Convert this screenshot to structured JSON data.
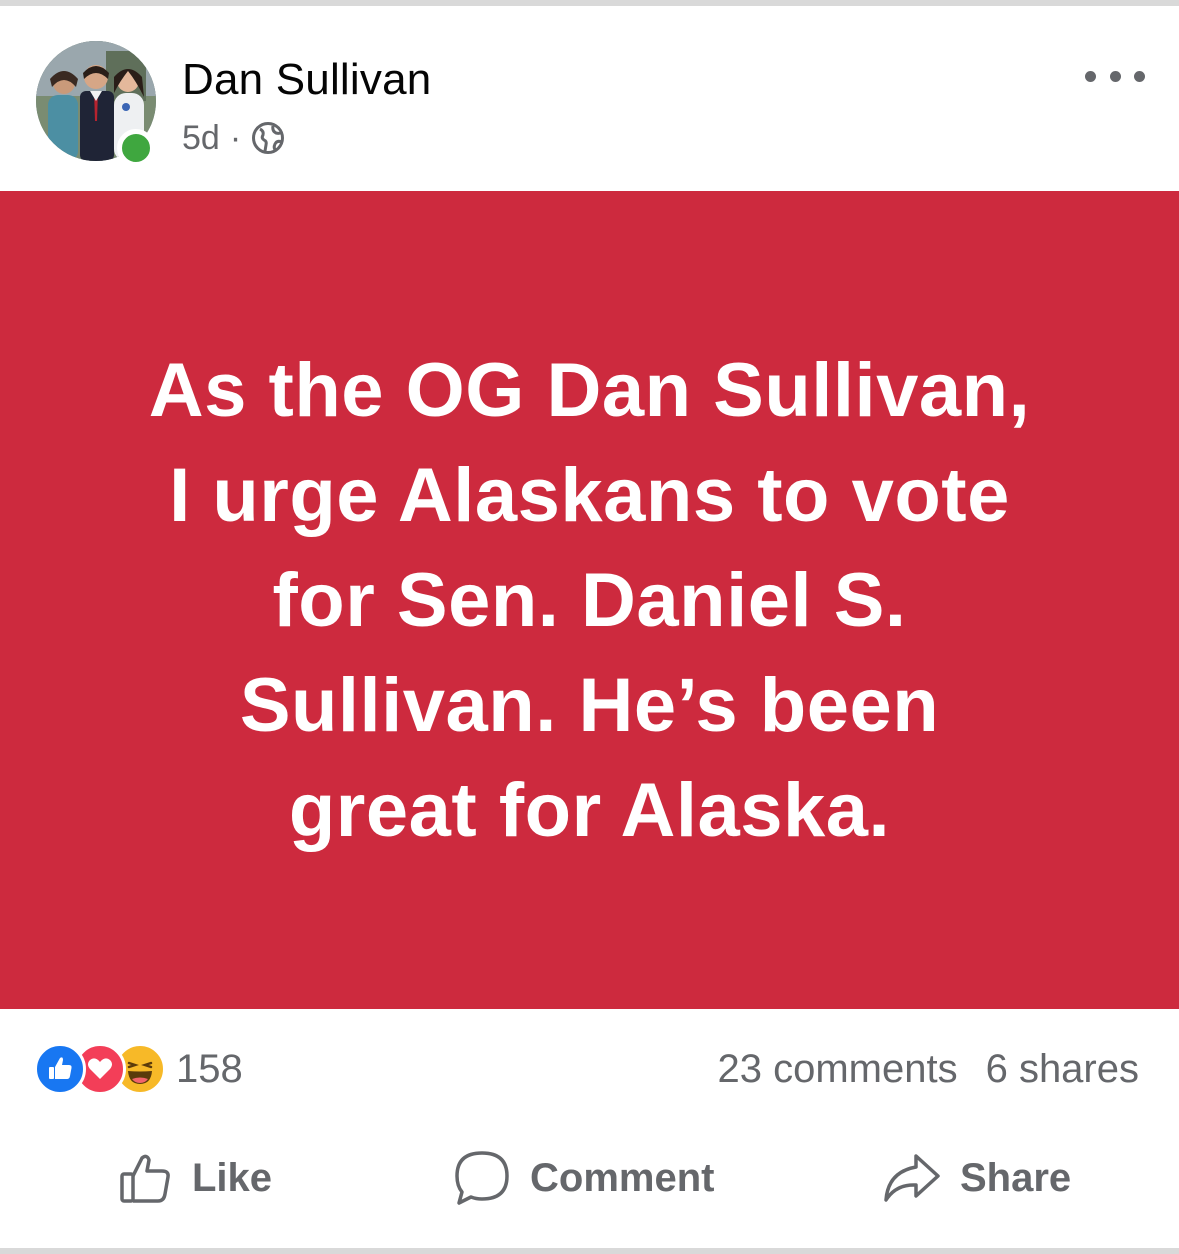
{
  "post": {
    "author": "Dan Sullivan",
    "time": "5d",
    "separator": "·",
    "audience_icon": "globe-icon",
    "online": true,
    "more_icon": "more-horizontal-icon"
  },
  "card": {
    "background": "#cd2a3e",
    "text_color": "#ffffff",
    "lines": [
      "As the OG Dan Sullivan,",
      "I urge Alaskans to vote",
      "for Sen. Daniel S.",
      "Sullivan.  He’s been",
      "great for Alaska."
    ]
  },
  "stats": {
    "reaction_icons": [
      "like-reaction-icon",
      "love-reaction-icon",
      "haha-reaction-icon"
    ],
    "reaction_count": "158",
    "comments": "23 comments",
    "shares": "6 shares"
  },
  "actions": {
    "like": "Like",
    "comment": "Comment",
    "share": "Share"
  },
  "colors": {
    "secondary_text": "#65676b",
    "like_blue": "#1877f2",
    "love_red": "#f33e58",
    "haha_yellow": "#f7b928",
    "online_green": "#3fa73f"
  }
}
